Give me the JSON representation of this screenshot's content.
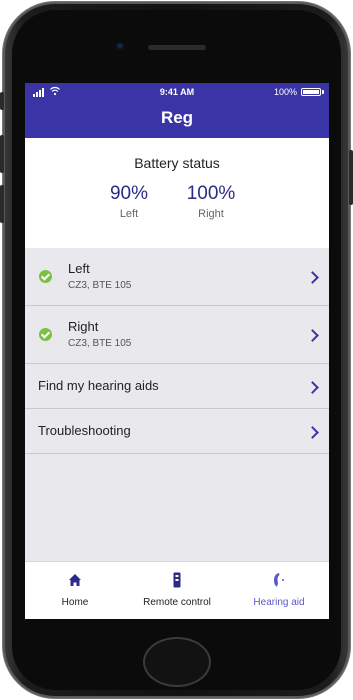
{
  "status_bar": {
    "time": "9:41 AM",
    "battery": "100%"
  },
  "header": {
    "title": "Reg"
  },
  "battery": {
    "title": "Battery status",
    "left": {
      "value": "90%",
      "label": "Left"
    },
    "right": {
      "value": "100%",
      "label": "Right"
    }
  },
  "devices": [
    {
      "name": "Left",
      "model": "CZ3, BTE 105",
      "status_color": "#7ac143"
    },
    {
      "name": "Right",
      "model": "CZ3, BTE 105",
      "status_color": "#7ac143"
    }
  ],
  "menu": [
    {
      "label": "Find my hearing aids"
    },
    {
      "label": "Troubleshooting"
    }
  ],
  "tabs": [
    {
      "label": "Home",
      "icon": "home-icon"
    },
    {
      "label": "Remote control",
      "icon": "remote-control-icon"
    },
    {
      "label": "Hearing aid",
      "icon": "hearing-aid-icon",
      "active": true
    }
  ],
  "colors": {
    "brand": "#3b34a6",
    "accent": "#5b57c8",
    "ok": "#7ac143"
  }
}
